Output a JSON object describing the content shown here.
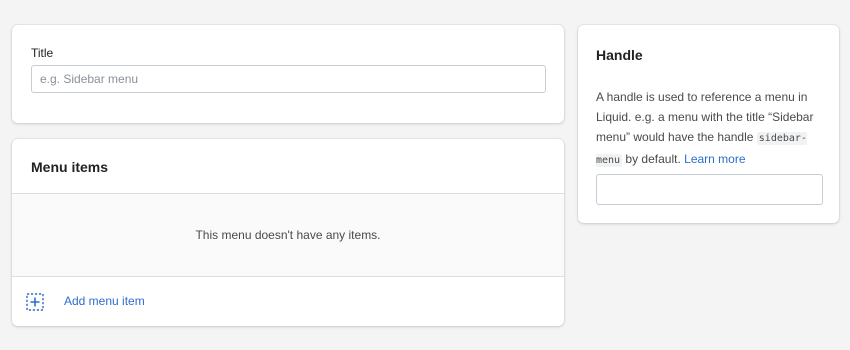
{
  "title_card": {
    "label": "Title",
    "input_value": "",
    "input_placeholder": "e.g. Sidebar menu"
  },
  "menu_card": {
    "heading": "Menu items",
    "empty_message": "This menu doesn't have any items.",
    "add_item_label": "Add menu item",
    "add_item_icon": "plus-square-icon"
  },
  "handle_card": {
    "heading": "Handle",
    "desc_part1": "A handle is used to reference a menu in Liquid. e.g. a menu with the title “Sidebar menu” would have the handle ",
    "desc_code": "sidebar-menu",
    "desc_part2": " by default. ",
    "learn_more": "Learn more",
    "input_value": ""
  },
  "colors": {
    "background": "#f4f4f5",
    "link": "#2c6ecb",
    "border": "#c4cdd5"
  }
}
